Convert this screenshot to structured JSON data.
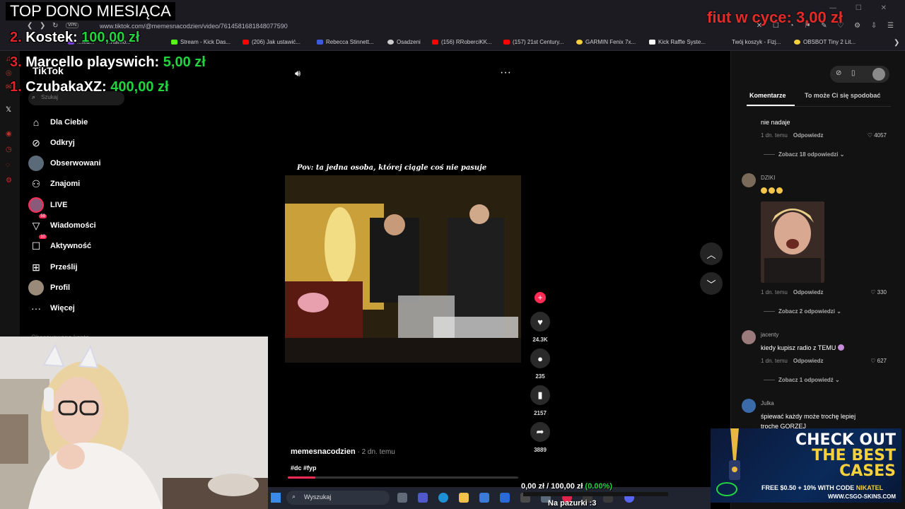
{
  "browser": {
    "url": "www.tiktok.com/@memesnacodzien/video/7614581681848077590",
    "vpn": "VPN",
    "bookmarks": [
      {
        "label": "...Mu...",
        "color": "#7a3fd6"
      },
      {
        "label": "...Karho...",
        "color": "#555555"
      },
      {
        "label": "Stream - Kick Das...",
        "color": "#53fc18"
      },
      {
        "label": "(206) Jak ustawić...",
        "color": "#ff0000"
      },
      {
        "label": "Rebecca Stinnett...",
        "color": "#3b5bdb"
      },
      {
        "label": "Osadzeni",
        "color": "#cccccc"
      },
      {
        "label": "(156) RRoberciKK...",
        "color": "#ff0000"
      },
      {
        "label": "(157) 21st Century...",
        "color": "#ff0000"
      },
      {
        "label": "GARMIN Fenix 7x...",
        "color": "#f6d13c"
      },
      {
        "label": "Kick Raffle Syste...",
        "color": "#ffffff"
      },
      {
        "label": "Twój koszyk - Fizj...",
        "color": "#888888"
      },
      {
        "label": "OBSBOT Tiny 2 Lit...",
        "color": "#f6d13c"
      }
    ]
  },
  "overlay": {
    "title": "TOP DONO MIESIĄCA",
    "donors": [
      {
        "rank": "2.",
        "name": "Kostek:",
        "amount": "100,00 zł"
      },
      {
        "rank": "3.",
        "name": "Marcello playswich:",
        "amount": "5,00 zł"
      },
      {
        "rank": "1.",
        "name": "CzubakaXZ:",
        "amount": "400,00 zł"
      }
    ],
    "counter_label": "fiut w cyce:",
    "counter_value": "3,00 zł"
  },
  "sidebar": {
    "logo": "TikTok",
    "search_placeholder": "Szukaj",
    "items": [
      {
        "label": "Dla Ciebie",
        "icon": "home-icon"
      },
      {
        "label": "Odkryj",
        "icon": "compass-icon"
      },
      {
        "label": "Obserwowani",
        "icon": "avatar"
      },
      {
        "label": "Znajomi",
        "icon": "friends-icon"
      },
      {
        "label": "LIVE",
        "icon": "live-icon"
      },
      {
        "label": "Wiadomości",
        "icon": "inbox-icon",
        "badge": "59"
      },
      {
        "label": "Aktywność",
        "icon": "message-icon",
        "badge": "10"
      },
      {
        "label": "Prześlij",
        "icon": "upload-icon"
      },
      {
        "label": "Profil",
        "icon": "avatar"
      },
      {
        "label": "Więcej",
        "icon": "more-icon"
      }
    ],
    "followed_label": "Obserwowane konta"
  },
  "video": {
    "caption": "Pov: ta jedna osoba, której ciągle coś nie pasuje",
    "author": "memesnacodzien",
    "age": " · 2 dn. temu",
    "tags": "#dc #fyp",
    "progress": 0.12,
    "likes": "24.3K",
    "comments": "235",
    "saves": "2157",
    "shares": "3889"
  },
  "panel": {
    "tabs": [
      "Komentarze",
      "To może Ci się spodobać"
    ],
    "comments": [
      {
        "text": "nie nadaje",
        "meta": "1 dn. temu",
        "reply": "Odpowiedz",
        "likes": "4057",
        "more": "Zobacz 18 odpowiedzi"
      },
      {
        "user": "DZIKI",
        "meta": "1 dn. temu",
        "reply": "Odpowiedz",
        "likes": "330",
        "more": "Zobacz 2 odpowiedzi"
      },
      {
        "user": "jacenty",
        "text": "kiedy kupisz radio z TEMU",
        "meta": "1 dn. temu",
        "reply": "Odpowiedz",
        "likes": "627",
        "more": "Zobacz 1 odpowiedź"
      },
      {
        "user": "Julka",
        "text": "śpiewać każdy może trochę lepiej",
        "text2": "trochę GORZEJ"
      }
    ]
  },
  "ad": {
    "line1": "CHECK OUT",
    "line2": "THE BEST",
    "line3": "CASES",
    "promo_a": "FREE $0.50 + 10% WITH CODE ",
    "promo_code": "NIKATEL",
    "url": "WWW.CSGO-SKINS.COM"
  },
  "taskbar": {
    "search": "Wyszukaj"
  },
  "goal": {
    "current": "0,00 zł",
    "sep": " / ",
    "target": "100,00 zł",
    "pct": "(0.00%)",
    "subtitle": "Na pazurki :3"
  }
}
